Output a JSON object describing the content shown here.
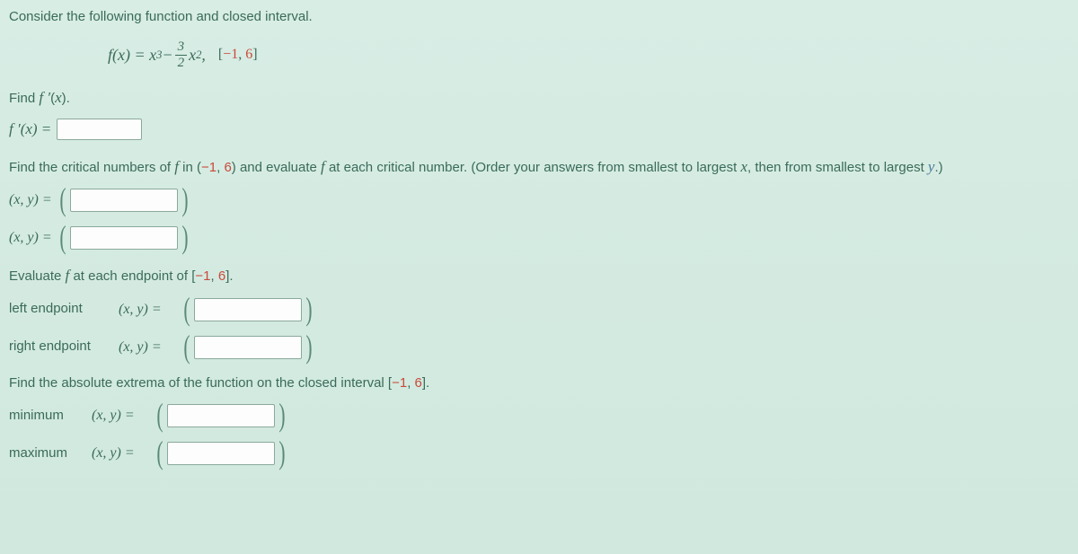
{
  "intro": "Consider the following function and closed interval.",
  "formula": {
    "fx_eq": "f(x) = x",
    "exp1": "3",
    "minus": " − ",
    "frac_num": "3",
    "frac_den": "2",
    "x2": "x",
    "exp2": "2",
    "comma": ",",
    "interval_open": "[",
    "interval_a": "−1",
    "interval_sep": ", ",
    "interval_b": "6",
    "interval_close": "]"
  },
  "find_fprime": "Find f ′(x).",
  "fprime_label": "f ′(x) =",
  "critical_instruction": "Find the critical numbers of f in (−1, 6) and evaluate f at each critical number. (Order your answers from smallest to largest x, then from smallest to largest y.)",
  "xy_label": "(x, y)  =",
  "evaluate_endpoints": "Evaluate f at each endpoint of [−1, 6].",
  "left_endpoint": "left endpoint",
  "right_endpoint": "right endpoint",
  "extrema_instruction": "Find the absolute extrema of the function on the closed interval [−1, 6].",
  "minimum": "minimum",
  "maximum": "maximum"
}
